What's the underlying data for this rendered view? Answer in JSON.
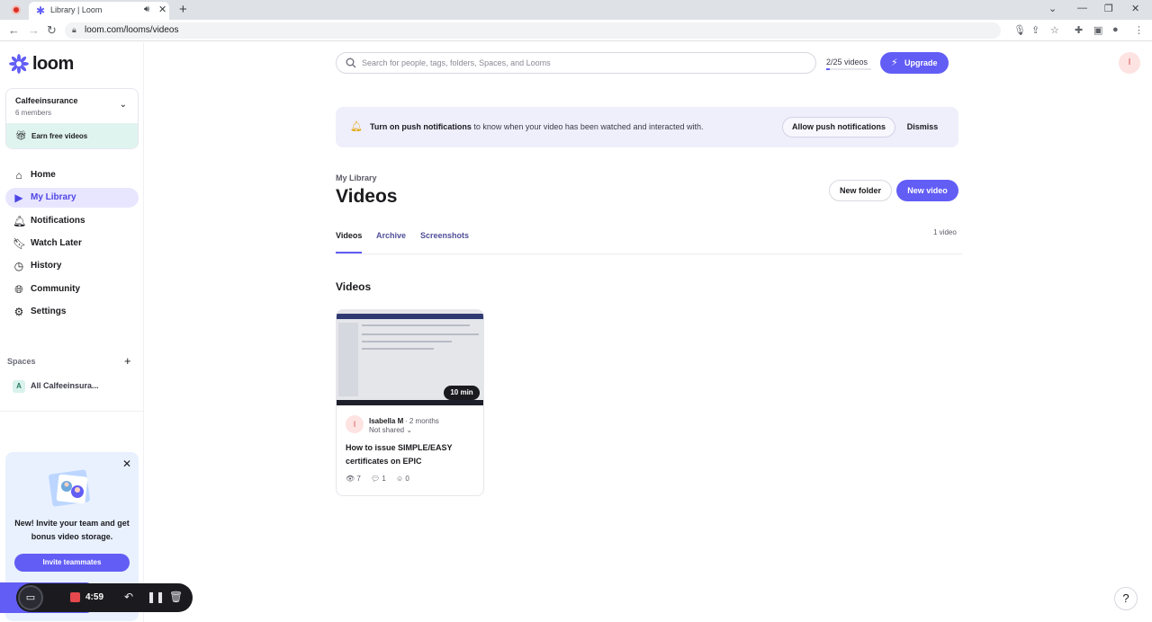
{
  "browser": {
    "tab_title": "Library | Loom",
    "url": "loom.com/looms/videos"
  },
  "brand": {
    "name": "loom",
    "color": "#625df5"
  },
  "workspace": {
    "name": "Calfeeinsurance",
    "members": "6 members",
    "earn_label": "Earn free videos"
  },
  "nav": [
    {
      "label": "Home",
      "icon": "home-icon"
    },
    {
      "label": "My Library",
      "icon": "library-icon",
      "active": true
    },
    {
      "label": "Notifications",
      "icon": "bell-icon"
    },
    {
      "label": "Watch Later",
      "icon": "bookmark-icon"
    },
    {
      "label": "History",
      "icon": "clock-icon"
    },
    {
      "label": "Community",
      "icon": "globe-icon"
    },
    {
      "label": "Settings",
      "icon": "gear-icon"
    }
  ],
  "spaces": {
    "heading": "Spaces",
    "items": [
      {
        "badge": "A",
        "label": "All Calfeeinsura..."
      }
    ]
  },
  "promo": {
    "text": "New! Invite your team and get bonus video storage.",
    "button": "Invite teammates"
  },
  "recorder": {
    "time": "4:59"
  },
  "search": {
    "placeholder": "Search for people, tags, folders, Spaces, and Looms"
  },
  "quota": {
    "label": "2/25 videos",
    "used": 2,
    "total": 25
  },
  "upgrade_label": "Upgrade",
  "user_initial": "I",
  "banner": {
    "bold": "Turn on push notifications",
    "rest": " to know when your video has been watched and interacted with.",
    "allow": "Allow push notifications",
    "dismiss": "Dismiss"
  },
  "page": {
    "breadcrumb": "My Library",
    "title": "Videos",
    "new_folder": "New folder",
    "new_video": "New video",
    "tabs": [
      "Videos",
      "Archive",
      "Screenshots"
    ],
    "count": "1 video",
    "section": "Videos"
  },
  "videos": [
    {
      "duration": "10 min",
      "author_initial": "I",
      "author": "Isabella M",
      "age": "· 2 months",
      "sharing": "Not shared",
      "title": "How to issue SIMPLE/EASY certificates on EPIC",
      "views": "7",
      "comments": "1",
      "reactions": "0"
    }
  ],
  "help": "?"
}
